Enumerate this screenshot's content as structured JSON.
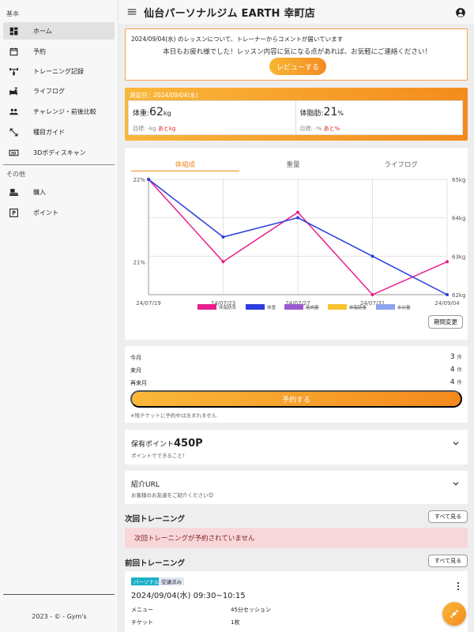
{
  "sidebar": {
    "section_basic": "基本",
    "items": [
      {
        "label": "ホーム",
        "icon": "dashboard-icon"
      },
      {
        "label": "予約",
        "icon": "calendar-edit-icon"
      },
      {
        "label": "トレーニング記録",
        "icon": "weightlifter-icon"
      },
      {
        "label": "ライフログ",
        "icon": "bed-icon"
      },
      {
        "label": "チャレンジ・前後比較",
        "icon": "people-icon"
      },
      {
        "label": "種目ガイド",
        "icon": "resize-icon"
      },
      {
        "label": "3Dボディスキャン",
        "icon": "3d-icon"
      }
    ],
    "section_other": "その他",
    "other_items": [
      {
        "label": "購入",
        "icon": "shop-icon"
      },
      {
        "label": "ポイント",
        "icon": "parking-icon"
      }
    ],
    "footer": "2023 - © - Gym's"
  },
  "header": {
    "title": "仙台パーソナルジム EARTH 幸町店"
  },
  "comment": {
    "title": "2024/09/04(水) のレッスンについて、トレーナーからコメントが届いています",
    "body": "本日もお疲れ様でした！レッスン内容に気になる点があれば、お気軽にご連絡ください！",
    "button": "レビューする"
  },
  "measure": {
    "date": "測定日：2024/09/04(水)",
    "weight": {
      "label": "体重:",
      "value": "62",
      "unit": "kg",
      "goal": "目標: -kg",
      "remain": "あとkg"
    },
    "fat": {
      "label": "体脂肪:",
      "value": "21",
      "unit": "%",
      "goal": "目標: -%",
      "remain": "あと%"
    }
  },
  "chart_tabs": [
    "体組成",
    "重量",
    "ライフログ"
  ],
  "chart_data": {
    "type": "line",
    "x": [
      "24/07/19",
      "24/07/23",
      "24/07/27",
      "24/07/31",
      "24/09/04"
    ],
    "series": [
      {
        "name": "体脂肪率",
        "color": "#e91e8c",
        "axis": "left",
        "values": [
          22,
          21,
          21.6,
          20.6,
          21
        ]
      },
      {
        "name": "体重",
        "color": "#2a3fdb",
        "axis": "right",
        "values": [
          65,
          63.5,
          64,
          63,
          62
        ]
      },
      {
        "name": "筋肉量",
        "color": "#9b59d0",
        "axis": "right",
        "values": []
      },
      {
        "name": "体脂肪量",
        "color": "#f6c430",
        "axis": "right",
        "values": []
      },
      {
        "name": "水分量",
        "color": "#8ea3f0",
        "axis": "right",
        "values": []
      }
    ],
    "left_ticks": [
      "22%",
      "21%"
    ],
    "right_ticks": [
      "65kg",
      "64kg",
      "63kg",
      "62kg"
    ],
    "ylim_left": [
      20.6,
      22
    ],
    "ylim_right": [
      62,
      65
    ]
  },
  "period_button": "期間変更",
  "reservations": {
    "rows": [
      {
        "label": "今月",
        "count": "3",
        "unit": "件"
      },
      {
        "label": "来月",
        "count": "4",
        "unit": "件"
      },
      {
        "label": "再来月",
        "count": "4",
        "unit": "件"
      }
    ],
    "button": "予約する",
    "note": "※残チケットに予約中は含まれません"
  },
  "points": {
    "title": "保有ポイント",
    "value": "450P",
    "sub": "ポイントでできること！"
  },
  "referral": {
    "title": "紹介URL",
    "sub": "お客様のお友達をご紹介ください😊"
  },
  "next_training": {
    "title": "次回トレーニング",
    "see_all": "すべて見る",
    "empty": "次回トレーニングが予約されていません"
  },
  "last_training": {
    "title": "前回トレーニング",
    "see_all": "すべて見る",
    "badge_type": "パーソナル",
    "badge_status": "受講済み",
    "datetime": "2024/09/04(水) 09:30~10:15",
    "menu_label": "メニュー",
    "menu_value": "45分セッション",
    "ticket_label": "チケット",
    "ticket_value": "1枚"
  }
}
